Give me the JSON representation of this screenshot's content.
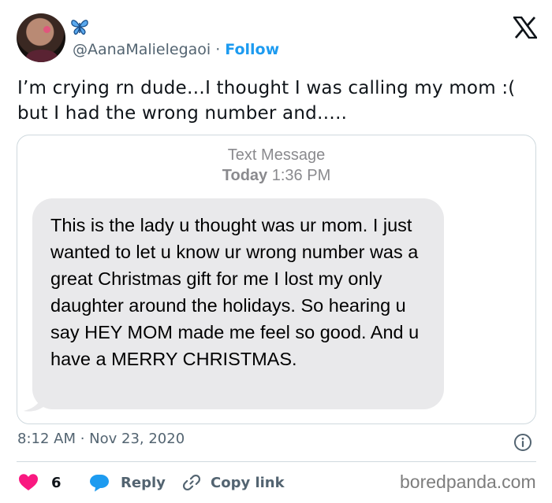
{
  "author": {
    "handle": "@AanaMalielegaoi",
    "separator": "·",
    "follow_label": "Follow",
    "name_emoji_icon": "butterfly-icon"
  },
  "brand_icon": "x-logo-icon",
  "tweet_text": "I’m crying rn dude…I thought I was calling my mom :( but I had the wrong number and…..",
  "embedded_sms": {
    "header_line1": "Text Message",
    "header_day": "Today",
    "header_time": "1:36 PM",
    "message": "This is the lady u thought was ur mom. I just wanted to let u know ur wrong number was a great Christmas gift for me I lost my only daughter around the holidays. So hearing u say HEY MOM made me feel so good. And u have a MERRY CHRISTMAS."
  },
  "timestamp": "8:12 AM · Nov 23, 2020",
  "actions": {
    "like_count": "6",
    "reply_label": "Reply",
    "copy_link_label": "Copy link"
  },
  "watermark": "boredpanda.com",
  "colors": {
    "accent": "#1d9bf0",
    "like": "#f91880",
    "muted_text": "#536471",
    "bubble": "#e9e9eb"
  }
}
